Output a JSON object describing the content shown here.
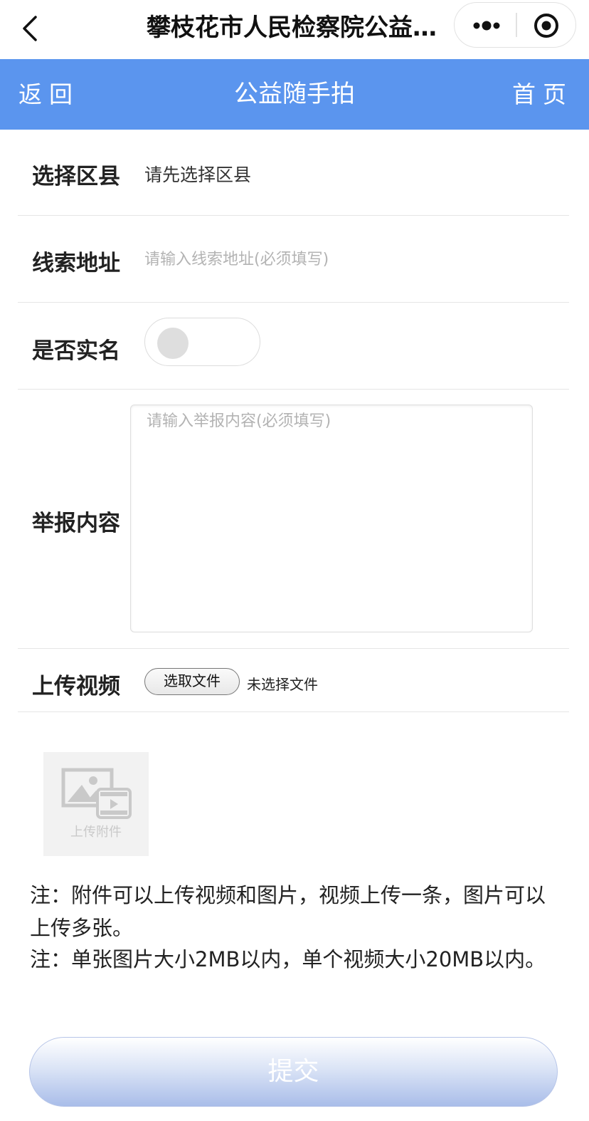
{
  "topbar": {
    "title": "攀枝花市人民检察院公益…"
  },
  "header": {
    "back_label": "返回",
    "title": "公益随手拍",
    "home_label": "首页",
    "color": "#5b95ee"
  },
  "form": {
    "district": {
      "label": "选择区县",
      "value": "请先选择区县"
    },
    "address": {
      "label": "线索地址",
      "placeholder": "请输入线索地址(必须填写)",
      "value": ""
    },
    "realname": {
      "label": "是否实名",
      "checked": false
    },
    "content": {
      "label": "举报内容",
      "placeholder": "请输入举报内容(必须填写)",
      "value": ""
    },
    "video": {
      "label": "上传视频",
      "button_label": "选取文件",
      "status": "未选择文件"
    }
  },
  "upload": {
    "caption": "上传附件",
    "icon": "image-video-icon"
  },
  "notes": [
    "注：附件可以上传视频和图片，视频上传一条，图片可以上传多张。",
    "注：单张图片大小2MB以内，单个视频大小20MB以内。"
  ],
  "submit_label": "提交"
}
